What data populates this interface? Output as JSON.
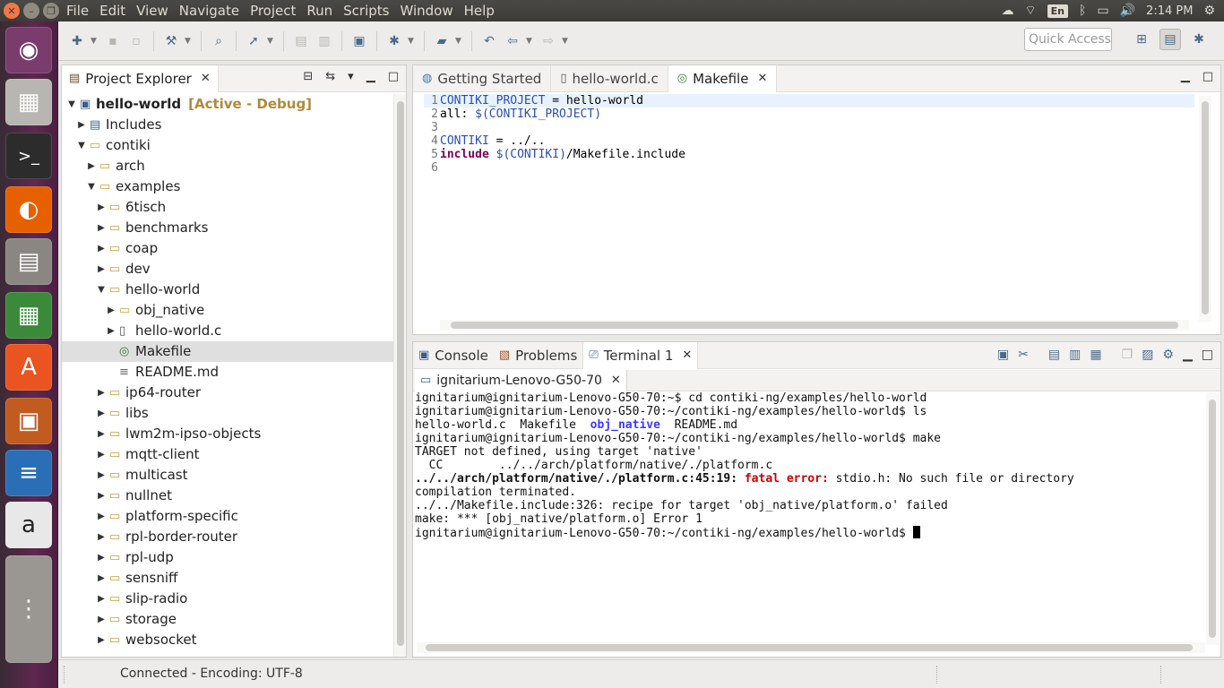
{
  "topbar": {
    "menus": [
      "File",
      "Edit",
      "View",
      "Navigate",
      "Project",
      "Run",
      "Scripts",
      "Window",
      "Help"
    ],
    "lang": "En",
    "clock": "2:14 PM",
    "icons": [
      "cloud-icon",
      "wifi-icon",
      "keyboard-lang-icon",
      "bluetooth-icon",
      "battery-icon",
      "volume-icon",
      "power-gear-icon"
    ]
  },
  "launcher": [
    "ubuntu-dash",
    "cube-app",
    "terminal",
    "firefox",
    "files",
    "libreoffice-calc",
    "software-center",
    "libreoffice-impress",
    "libreoffice-writer",
    "amazon",
    "more-apps"
  ],
  "toolbar": {
    "quick_access_placeholder": "Quick Access"
  },
  "explorer": {
    "title": "Project Explorer",
    "tree": [
      {
        "label": "hello-world",
        "suffix": "[Active - Debug]",
        "depth": 0,
        "twisty": "down",
        "icon": "project",
        "bold": true
      },
      {
        "label": "Includes",
        "depth": 1,
        "twisty": "right",
        "icon": "includes"
      },
      {
        "label": "contiki",
        "depth": 1,
        "twisty": "down",
        "icon": "folder"
      },
      {
        "label": "arch",
        "depth": 2,
        "twisty": "right",
        "icon": "folder"
      },
      {
        "label": "examples",
        "depth": 2,
        "twisty": "down",
        "icon": "folder"
      },
      {
        "label": "6tisch",
        "depth": 3,
        "twisty": "right",
        "icon": "folder"
      },
      {
        "label": "benchmarks",
        "depth": 3,
        "twisty": "right",
        "icon": "folder"
      },
      {
        "label": "coap",
        "depth": 3,
        "twisty": "right",
        "icon": "folder"
      },
      {
        "label": "dev",
        "depth": 3,
        "twisty": "right",
        "icon": "folder"
      },
      {
        "label": "hello-world",
        "depth": 3,
        "twisty": "down",
        "icon": "folder"
      },
      {
        "label": "obj_native",
        "depth": 4,
        "twisty": "right",
        "icon": "folder"
      },
      {
        "label": "hello-world.c",
        "depth": 4,
        "twisty": "right",
        "icon": "c-file"
      },
      {
        "label": "Makefile",
        "depth": 4,
        "twisty": "",
        "icon": "makefile",
        "selected": true
      },
      {
        "label": "README.md",
        "depth": 4,
        "twisty": "",
        "icon": "text-file"
      },
      {
        "label": "ip64-router",
        "depth": 3,
        "twisty": "right",
        "icon": "folder"
      },
      {
        "label": "libs",
        "depth": 3,
        "twisty": "right",
        "icon": "folder"
      },
      {
        "label": "lwm2m-ipso-objects",
        "depth": 3,
        "twisty": "right",
        "icon": "folder"
      },
      {
        "label": "mqtt-client",
        "depth": 3,
        "twisty": "right",
        "icon": "folder"
      },
      {
        "label": "multicast",
        "depth": 3,
        "twisty": "right",
        "icon": "folder"
      },
      {
        "label": "nullnet",
        "depth": 3,
        "twisty": "right",
        "icon": "folder"
      },
      {
        "label": "platform-specific",
        "depth": 3,
        "twisty": "right",
        "icon": "folder"
      },
      {
        "label": "rpl-border-router",
        "depth": 3,
        "twisty": "right",
        "icon": "folder"
      },
      {
        "label": "rpl-udp",
        "depth": 3,
        "twisty": "right",
        "icon": "folder"
      },
      {
        "label": "sensniff",
        "depth": 3,
        "twisty": "right",
        "icon": "folder"
      },
      {
        "label": "slip-radio",
        "depth": 3,
        "twisty": "right",
        "icon": "folder"
      },
      {
        "label": "storage",
        "depth": 3,
        "twisty": "right",
        "icon": "folder"
      },
      {
        "label": "websocket",
        "depth": 3,
        "twisty": "right",
        "icon": "folder"
      }
    ]
  },
  "editor": {
    "tabs": [
      {
        "label": "Getting Started",
        "active": false
      },
      {
        "label": "hello-world.c",
        "active": false
      },
      {
        "label": "Makefile",
        "active": true
      }
    ],
    "lines": [
      {
        "num": "1",
        "parts": [
          {
            "t": "CONTIKI_PROJECT",
            "c": "var"
          },
          {
            "t": " = hello-world",
            "c": "plain"
          }
        ]
      },
      {
        "num": "2",
        "parts": [
          {
            "t": "all: ",
            "c": "plain"
          },
          {
            "t": "$(CONTIKI_PROJECT)",
            "c": "var"
          }
        ]
      },
      {
        "num": "3",
        "parts": []
      },
      {
        "num": "4",
        "parts": [
          {
            "t": "CONTIKI",
            "c": "var"
          },
          {
            "t": " = ../..",
            "c": "plain"
          }
        ]
      },
      {
        "num": "5",
        "parts": [
          {
            "t": "include",
            "c": "kw"
          },
          {
            "t": " ",
            "c": "plain"
          },
          {
            "t": "$(CONTIKI)",
            "c": "var"
          },
          {
            "t": "/Makefile.include",
            "c": "plain"
          }
        ]
      },
      {
        "num": "6",
        "parts": []
      }
    ]
  },
  "bottom": {
    "tabs": [
      {
        "label": "Console",
        "active": false
      },
      {
        "label": "Problems",
        "active": false
      },
      {
        "label": "Terminal 1",
        "active": true
      }
    ],
    "terminal_tab": "ignitarium-Lenovo-G50-70",
    "terminal_lines": [
      [
        {
          "t": "ignitarium@ignitarium-Lenovo-G50-70:~$ cd contiki-ng/examples/hello-world",
          "c": ""
        }
      ],
      [
        {
          "t": "ignitarium@ignitarium-Lenovo-G50-70:~/contiki-ng/examples/hello-world$ ls",
          "c": ""
        }
      ],
      [
        {
          "t": "hello-world.c  Makefile  ",
          "c": ""
        },
        {
          "t": "obj_native",
          "c": "t-blue"
        },
        {
          "t": "  README.md",
          "c": ""
        }
      ],
      [
        {
          "t": "ignitarium@ignitarium-Lenovo-G50-70:~/contiki-ng/examples/hello-world$ make",
          "c": ""
        }
      ],
      [
        {
          "t": "TARGET not defined, using target 'native'",
          "c": ""
        }
      ],
      [
        {
          "t": "  CC        ../../arch/platform/native/./platform.c",
          "c": ""
        }
      ],
      [
        {
          "t": "../../arch/platform/native/./platform.c:45:19: ",
          "c": "t-bold"
        },
        {
          "t": "fatal error: ",
          "c": "t-red"
        },
        {
          "t": "stdio.h: No such file or directory",
          "c": ""
        }
      ],
      [
        {
          "t": "compilation terminated.",
          "c": ""
        }
      ],
      [
        {
          "t": "../../Makefile.include:326: recipe for target 'obj_native/platform.o' failed",
          "c": ""
        }
      ],
      [
        {
          "t": "make: *** [obj_native/platform.o] Error 1",
          "c": ""
        }
      ],
      [
        {
          "t": "ignitarium@ignitarium-Lenovo-G50-70:~/contiki-ng/examples/hello-world$ ",
          "c": ""
        },
        {
          "t": "",
          "c": "cursor"
        }
      ]
    ]
  },
  "status": {
    "text": "Connected - Encoding: UTF-8"
  }
}
